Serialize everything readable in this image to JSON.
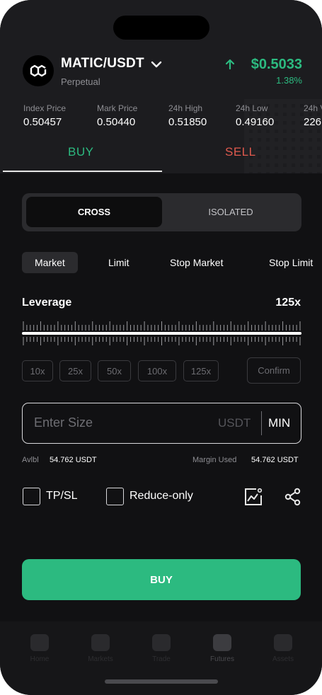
{
  "header": {
    "pair": "MATIC/USDT",
    "subtitle": "Perpetual",
    "price": "$0.5033",
    "change_pct": "1.38%",
    "logo_icon": "polygon-logo-icon"
  },
  "stats": [
    {
      "label": "Index Price",
      "value": "0.50457"
    },
    {
      "label": "Mark Price",
      "value": "0.50440"
    },
    {
      "label": "24h High",
      "value": "0.51850"
    },
    {
      "label": "24h Low",
      "value": "0.49160"
    },
    {
      "label": "24h V",
      "value": "226"
    }
  ],
  "tabs": {
    "buy": "BUY",
    "sell": "SELL"
  },
  "margin_mode": {
    "cross": "CROSS",
    "isolated": "ISOLATED",
    "selected": "CROSS"
  },
  "order_types": [
    "Market",
    "Limit",
    "Stop Market",
    "Stop Limit"
  ],
  "order_type_selected": "Market",
  "leverage": {
    "label": "Leverage",
    "value": "125x",
    "level": 1.0,
    "presets": [
      "10x",
      "25x",
      "50x",
      "100x",
      "125x"
    ],
    "confirm": "Confirm"
  },
  "size_input": {
    "placeholder": "Enter Size",
    "unit": "USDT",
    "min": "MIN"
  },
  "balances": {
    "avbl_label": "Avlbl",
    "avbl_value": "54.762 USDT",
    "margin_label": "Margin Used",
    "margin_value": "54.762 USDT"
  },
  "options": {
    "tpsl": "TP/SL",
    "reduce_only": "Reduce-only"
  },
  "actions": {
    "buy": "BUY"
  },
  "bottom_nav": [
    "Home",
    "Markets",
    "Trade",
    "Futures",
    "Assets"
  ],
  "colors": {
    "accent": "#2cba80",
    "sell": "#e05a4e",
    "background": "#111113",
    "header": "#1c1c1f"
  }
}
